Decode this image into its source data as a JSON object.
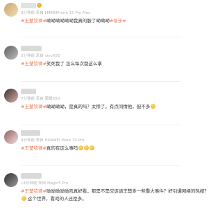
{
  "comments": [
    {
      "name": "",
      "meta": "3分钟前  来自 LM88iPhone 15 Pro Max",
      "tag": "#王楚钦律#",
      "body": "呦呦呦呦呦呦我真的服了呦呦呦",
      "tag2": "#哈乐#",
      "avatar_colors": [
        "#c9a66b",
        "#e7c99a"
      ]
    },
    {
      "name": "",
      "meta": "5分钟前  来自 vivoX50",
      "tag": "#王楚钦律#",
      "body": "笑死我了 怎么每次都这么拿",
      "avatar_colors": [
        "#6b6b6b",
        "#b8b8b8"
      ]
    },
    {
      "name": "",
      "meta": "7分钟前  来自 荣耀X50",
      "tag": "#王楚钦律#",
      "body": "呦呦呦呦，是真的吗？太惨了。有点同情他，但不多",
      "avatar_colors": [
        "#4a3a3a",
        "#c9a39a"
      ]
    },
    {
      "name": "",
      "meta": "9分钟前  来自 HUAWEI Mate 70 Pro",
      "tag": "#王楚钦律#",
      "body": "真的有这么事吗",
      "avatar_colors": [
        "#9a7070",
        "#e7cfcf"
      ]
    },
    {
      "name": "",
      "meta": "14分钟前  来自 Magic5 Pro",
      "tag": "#王楚钦律#",
      "body": "呦呦呦呦呦吼真好看，那是不是应该请王楚多一些重大事件？好引爆网络的热搜？",
      "line2": "这个世界，看戏的人还是多。",
      "avatar_colors": [
        "#3a3a3a",
        "#8c8c8c"
      ]
    }
  ]
}
